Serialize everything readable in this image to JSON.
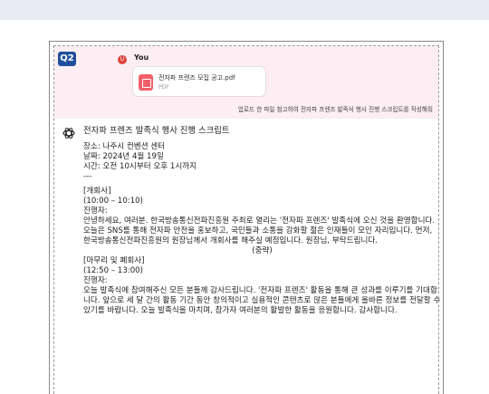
{
  "badge": "Q2",
  "user": {
    "avatar_letter": "U",
    "name": "You",
    "file_name": "전자파 프렌즈 모집 공고.pdf",
    "file_type": "PDF",
    "message": "업로드 한 파일 참고하여 전자파 프렌즈 발족식 행사 진행 스크립트를 작성해줘"
  },
  "answer": {
    "title": "전자파 프렌즈 발족식 행사 진행 스크립트",
    "place": "장소: 나주시 컨벤션 센터",
    "date": "날짜: 2024년 4월 19일",
    "time": "시간: 오전 10시부터 오후 1시까지",
    "divider": "---",
    "section1_title": "[개회사]",
    "section1_time": "(10:00 – 10:10)",
    "section1_speaker": "진행자:",
    "section1_body": "안녕하세요, 여러분. 한국방송통신전파진흥원 주최로 열리는 '전자파 프렌즈' 발족식에 오신 것을 환영합니다. 오늘은 SNS를 통해 전자파 안전을 홍보하고, 국민들과 소통을 강화할 젊은 인재들이 모인 자리입니다. 먼저, 한국방송통신전파진흥원의 원장님께서 개회사를 해주실 예정입니다. 원장님, 부탁드립니다.",
    "omitted": "(중략)",
    "section2_title": "[마무리 및 폐회사]",
    "section2_time": "(12:50 – 13:00)",
    "section2_speaker": "진행자:",
    "section2_body": "오늘 발족식에 참여해주신 모든 분들께 감사드립니다. '전자파 프렌즈' 활동을 통해 큰 성과를 이루기를 기대합니다. 앞으로 세 달 간의 활동 기간 동안 창의적이고 실용적인 콘텐츠로 많은 분들에게 올바른 정보를 전달할 수 있기를 바랍니다. 오늘 발족식을 마치며, 참가자 여러분의 활발한 활동을 응원합니다. 감사합니다."
  },
  "colors": {
    "badge": "#1f4f9c",
    "prompt_bg": "#fceef3",
    "avatar": "#e0443c",
    "pdf_icon": "#f25f6b"
  },
  "icons": [
    "openai-logo-icon",
    "pdf-file-icon",
    "user-avatar-icon"
  ]
}
